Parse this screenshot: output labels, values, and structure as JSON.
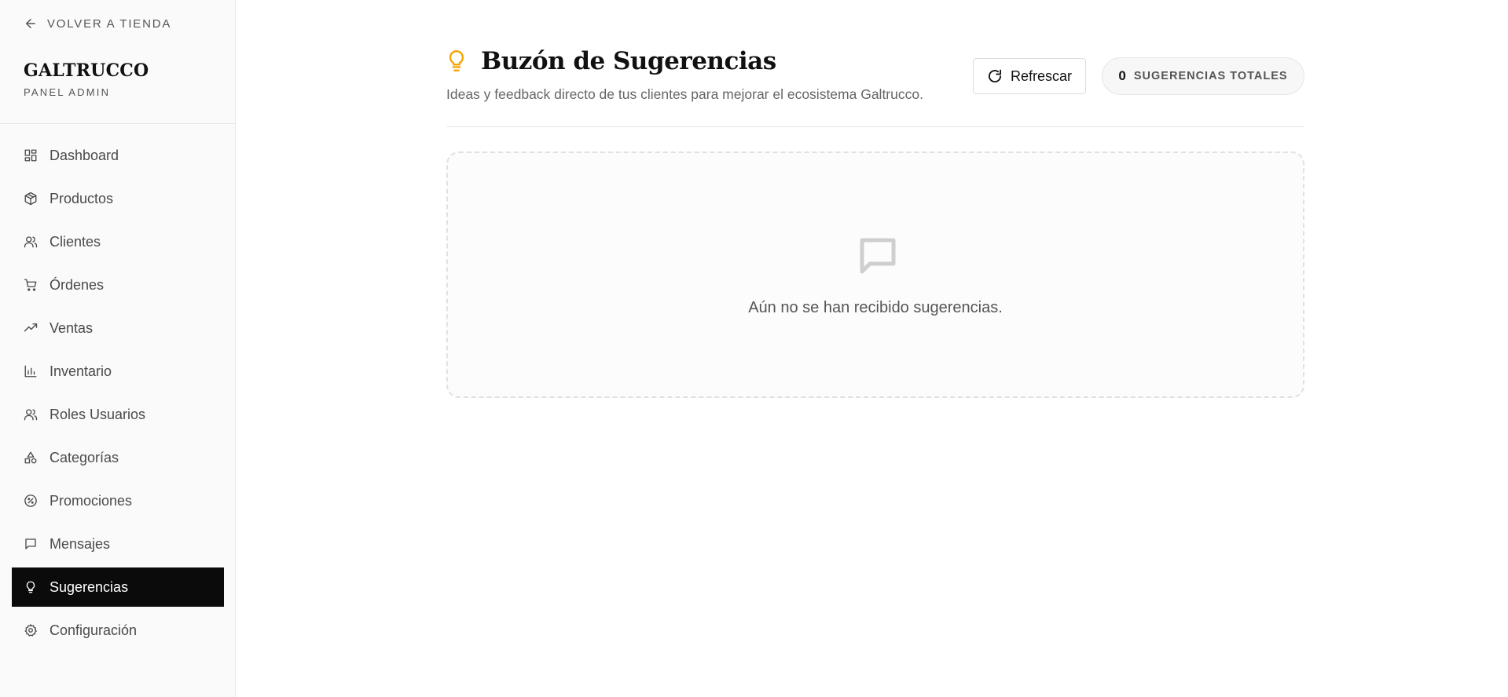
{
  "sidebar": {
    "back_label": "VOLVER A TIENDA",
    "brand_name": "GALTRUCCO",
    "brand_sub": "PANEL ADMIN",
    "items": [
      {
        "label": "Dashboard",
        "icon": "dashboard-icon"
      },
      {
        "label": "Productos",
        "icon": "package-icon"
      },
      {
        "label": "Clientes",
        "icon": "users-icon"
      },
      {
        "label": "Órdenes",
        "icon": "cart-icon"
      },
      {
        "label": "Ventas",
        "icon": "trending-up-icon"
      },
      {
        "label": "Inventario",
        "icon": "bar-chart-icon"
      },
      {
        "label": "Roles Usuarios",
        "icon": "users-icon"
      },
      {
        "label": "Categorías",
        "icon": "shapes-icon"
      },
      {
        "label": "Promociones",
        "icon": "percent-badge-icon"
      },
      {
        "label": "Mensajes",
        "icon": "message-icon"
      },
      {
        "label": "Sugerencias",
        "icon": "lightbulb-icon",
        "active": true
      },
      {
        "label": "Configuración",
        "icon": "gear-icon"
      }
    ]
  },
  "header": {
    "title": "Buzón de Sugerencias",
    "subtitle": "Ideas y feedback directo de tus clientes para mejorar el ecosistema Galtrucco.",
    "refresh_label": "Refrescar",
    "count": "0",
    "count_label": "SUGERENCIAS TOTALES"
  },
  "empty_state": {
    "message": "Aún no se han recibido sugerencias."
  },
  "colors": {
    "accent": "#f5a300",
    "active_bg": "#0b0b0b",
    "sidebar_bg": "#fafafa"
  }
}
